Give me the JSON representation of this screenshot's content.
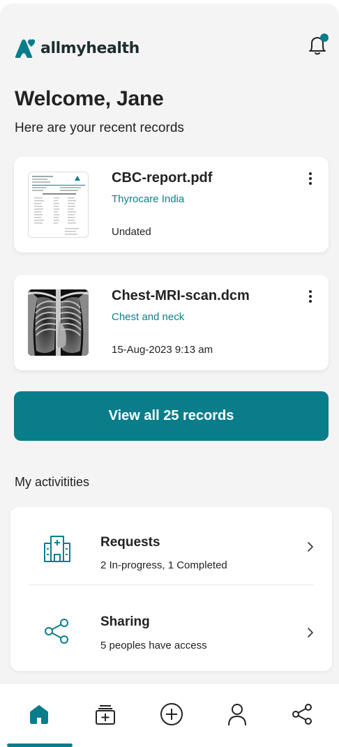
{
  "app": {
    "brand": "allmyhealth",
    "accent_color": "#0a7d8b",
    "notification_badge_color": "#0a7d8b"
  },
  "header": {
    "welcome": "Welcome, Jane",
    "subtitle": "Here are your recent records"
  },
  "records": [
    {
      "title": "CBC-report.pdf",
      "source": "Thyrocare India",
      "date": "Undated",
      "thumbnail": "document-preview"
    },
    {
      "title": "Chest-MRI-scan.dcm",
      "source": "Chest and neck",
      "date": "15-Aug-2023  9:13 am",
      "thumbnail": "chest-xray-image"
    }
  ],
  "view_all_label": "View all 25 records",
  "activities": {
    "section_title": "My activitities",
    "items": [
      {
        "title": "Requests",
        "subtitle": "2 In-progress, 1 Completed",
        "icon": "hospital-icon"
      },
      {
        "title": "Sharing",
        "subtitle": "5 peoples have access",
        "icon": "share-icon"
      }
    ]
  },
  "bottom_nav": {
    "items": [
      {
        "icon": "home-icon",
        "active": true
      },
      {
        "icon": "add-folder-icon",
        "active": false
      },
      {
        "icon": "add-circle-icon",
        "active": false
      },
      {
        "icon": "profile-icon",
        "active": false
      },
      {
        "icon": "share-icon",
        "active": false
      }
    ]
  }
}
